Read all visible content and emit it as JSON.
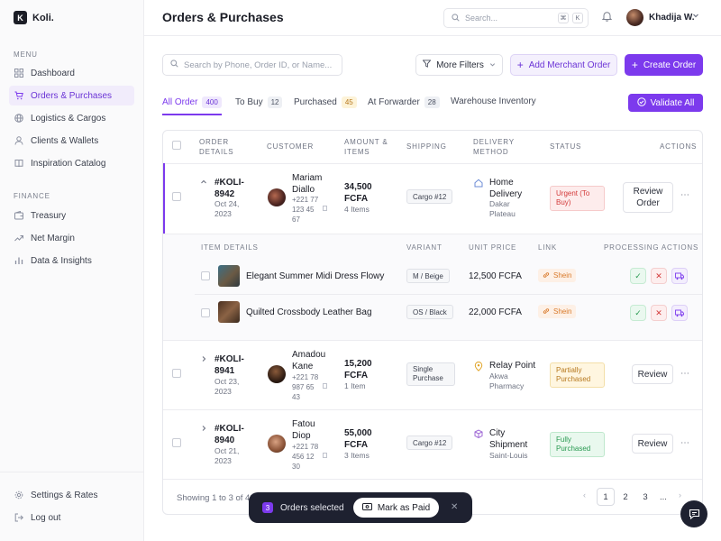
{
  "brand": {
    "logo_letter": "K",
    "name": "Koli."
  },
  "sidebar": {
    "menu_label": "MENU",
    "finance_label": "FINANCE",
    "items": [
      {
        "label": "Dashboard",
        "icon": "grid-icon"
      },
      {
        "label": "Orders & Purchases",
        "icon": "cart-icon",
        "active": true
      },
      {
        "label": "Logistics & Cargos",
        "icon": "globe-icon"
      },
      {
        "label": "Clients & Wallets",
        "icon": "user-icon"
      },
      {
        "label": "Inspiration Catalog",
        "icon": "book-icon"
      }
    ],
    "finance_items": [
      {
        "label": "Treasury",
        "icon": "wallet-icon"
      },
      {
        "label": "Net Margin",
        "icon": "trend-icon"
      },
      {
        "label": "Data & Insights",
        "icon": "bar-chart-icon"
      }
    ],
    "bottom_items": [
      {
        "label": "Settings & Rates",
        "icon": "gear-icon"
      },
      {
        "label": "Log out",
        "icon": "logout-icon"
      }
    ]
  },
  "header": {
    "title": "Orders & Purchases",
    "search_placeholder": "Search...",
    "shortcut_keys": [
      "⌘",
      "K"
    ],
    "user_name": "Khadija W."
  },
  "toolbar": {
    "search_placeholder": "Search by Phone, Order ID, or Name...",
    "more_filters": "More Filters",
    "add_merchant_order": "Add Merchant Order",
    "create_order": "Create Order",
    "validate_all": "Validate All"
  },
  "tabs": [
    {
      "label": "All Order",
      "count": "400",
      "active": true
    },
    {
      "label": "To Buy",
      "count": "12"
    },
    {
      "label": "Purchased",
      "count": "45"
    },
    {
      "label": "At Forwarder",
      "count": "28"
    },
    {
      "label": "Warehouse Inventory",
      "count": ""
    }
  ],
  "table": {
    "headers": {
      "order_details": "ORDER DETAILS",
      "customer": "CUSTOMER",
      "amount_items": "AMOUNT & ITEMS",
      "shipping": "SHIPPING",
      "delivery_method": "DELIVERY METHOD",
      "status": "STATUS",
      "actions": "ACTIONS"
    },
    "rows": [
      {
        "id": "#KOLI-8942",
        "date": "Oct 24, 2023",
        "customer_name": "Mariam Diallo",
        "phone": "+221 77 123 45 67",
        "amount": "34,500 FCFA",
        "items": "4 Items",
        "shipping": "Cargo #12",
        "delivery_name": "Home Delivery",
        "delivery_place": "Dakar Plateau",
        "status": "Urgent (To Buy)",
        "status_color": "#d33a3a",
        "action": "Review Order",
        "expanded": true
      },
      {
        "id": "#KOLI-8941",
        "date": "Oct 23, 2023",
        "customer_name": "Amadou Kane",
        "phone": "+221 78 987 65 43",
        "amount": "15,200 FCFA",
        "items": "1 Item",
        "shipping": "Single Purchase",
        "delivery_name": "Relay Point",
        "delivery_place": "Akwa Pharmacy",
        "status": "Partially Purchased",
        "status_color": "#b7791f",
        "action": "Review"
      },
      {
        "id": "#KOLI-8940",
        "date": "Oct 21, 2023",
        "customer_name": "Fatou Diop",
        "phone": "+221 78 456 12 30",
        "amount": "55,000 FCFA",
        "items": "3 Items",
        "shipping": "Cargo #12",
        "delivery_name": "City Shipment",
        "delivery_place": "Saint-Louis",
        "status": "Fully Purchased",
        "status_color": "#2a9a52",
        "action": "Review"
      }
    ],
    "sub_headers": {
      "item_details": "ITEM DETAILS",
      "variant": "VARIANT",
      "unit_price": "UNIT PRICE",
      "link": "LINK",
      "processing_actions": "PROCESSING ACTIONS"
    },
    "sub_items": [
      {
        "name": "Elegant Summer Midi Dress Flowy",
        "variant": "M / Beige",
        "price": "12,500 FCFA",
        "link": "Shein"
      },
      {
        "name": "Quilted Crossbody Leather Bag",
        "variant": "OS / Black",
        "price": "22,000 FCFA",
        "link": "Shein"
      }
    ],
    "footer": {
      "showing": "Showing 1 to 3 of 42",
      "pages": [
        "1",
        "2",
        "3",
        "..."
      ]
    }
  },
  "selection_bar": {
    "count": "3",
    "label": "Orders selected",
    "mark_paid": "Mark as Paid"
  },
  "colors": {
    "accent": "#7c3aed",
    "sidebar_active_bg": "#f1ecfb",
    "dark": "#1e2130"
  }
}
